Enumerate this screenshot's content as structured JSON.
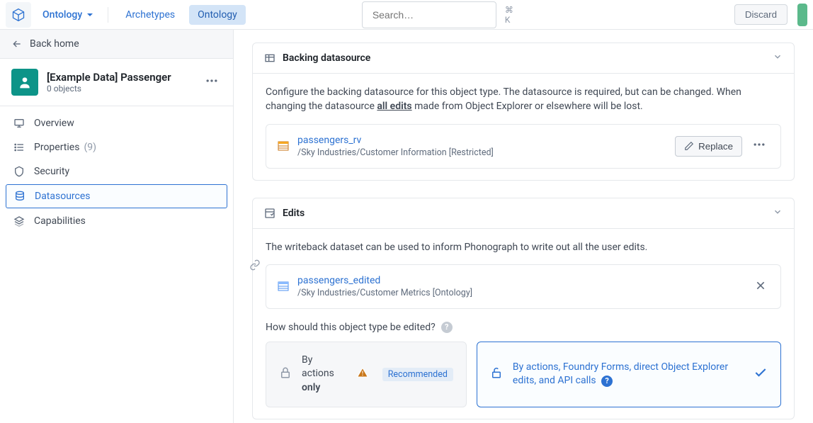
{
  "topbar": {
    "ontology_label": "Ontology",
    "tab_archetypes": "Archetypes",
    "tab_ontology": "Ontology",
    "search_placeholder": "Search…",
    "shortcut": "⌘ K",
    "discard": "Discard"
  },
  "sidebar": {
    "back": "Back home",
    "entity_title": "[Example Data] Passenger",
    "entity_sub": "0 objects",
    "nav": {
      "overview": "Overview",
      "properties": "Properties",
      "properties_count": "(9)",
      "security": "Security",
      "datasources": "Datasources",
      "capabilities": "Capabilities"
    }
  },
  "backing": {
    "title": "Backing datasource",
    "desc_pre": "Configure the backing datasource for this object type. The datasource is required, but can be changed. When changing the datasource ",
    "desc_strong": "all edits",
    "desc_post": " made from Object Explorer or elsewhere will be lost.",
    "ds_name": "passengers_rv",
    "ds_path": "/Sky Industries/Customer Information [Restricted]",
    "replace": "Replace"
  },
  "edits": {
    "title": "Edits",
    "desc": "The writeback dataset can be used to inform Phonograph to write out all the user edits.",
    "ds_name": "passengers_edited",
    "ds_path": "/Sky Industries/Customer Metrics [Ontology]",
    "question": "How should this object type be edited?",
    "option_a_pre": "By actions ",
    "option_a_bold": "only",
    "recommended": "Recommended",
    "option_b": "By actions, Foundry Forms, direct Object Explorer edits, and API calls"
  }
}
